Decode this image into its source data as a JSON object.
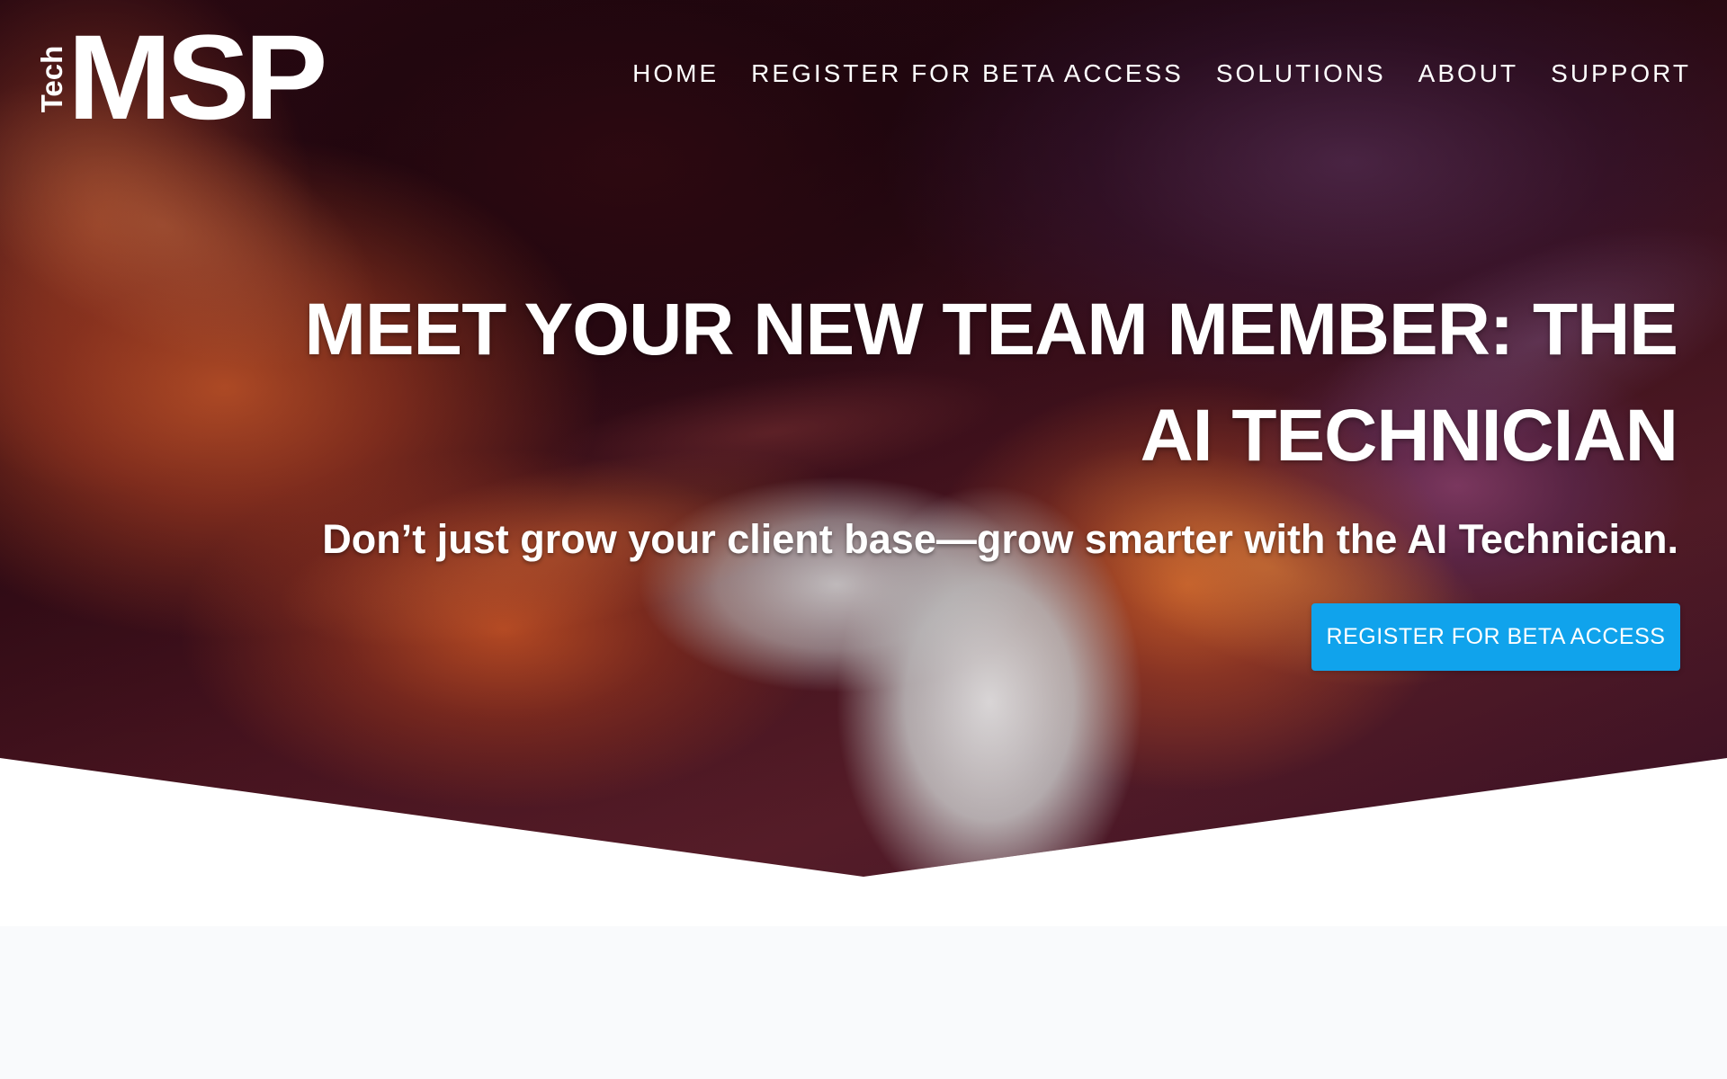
{
  "logo": {
    "tech": "Tech",
    "msp": "MSP"
  },
  "nav": {
    "items": [
      {
        "label": "HOME"
      },
      {
        "label": "REGISTER FOR BETA ACCESS"
      },
      {
        "label": "SOLUTIONS"
      },
      {
        "label": "ABOUT"
      },
      {
        "label": "SUPPORT"
      }
    ]
  },
  "hero": {
    "headline": "MEET YOUR NEW TEAM MEMBER: THE AI TECHNICIAN",
    "subheadline": "Don’t just grow your client base—grow smarter with the AI Technician.",
    "cta_label": "REGISTER FOR BETA ACCESS"
  },
  "colors": {
    "cta_background": "#10a3ec",
    "text": "#ffffff",
    "lower_band": "#f9fafc"
  }
}
